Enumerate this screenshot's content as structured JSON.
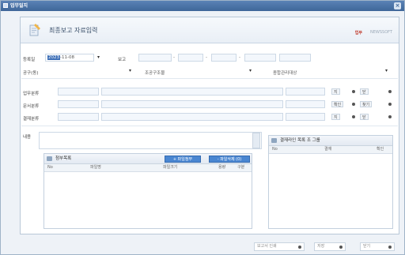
{
  "window": {
    "title": "업무일지"
  },
  "header": {
    "title": "최종보고 자료입력",
    "brand": "업무",
    "brand_sub": "NEWSSOFT"
  },
  "form": {
    "reg_date_label": "등록일",
    "reg_date_value_hl": "2023",
    "reg_date_value_rest": "-11-08",
    "report_label": "보고",
    "dept_label": "공구(동)",
    "section_label": "조공구조물",
    "type_label": "종합관리대상",
    "work_label": "업무분류",
    "doc_label": "문서분류",
    "recv_label": "결재분류",
    "memo_label": "내용"
  },
  "row_buttons": {
    "r1": [
      "지",
      "닫"
    ],
    "r2": [
      "확인",
      "찾기"
    ],
    "r3": [
      "지",
      "닫"
    ]
  },
  "attach": {
    "title": "첨부목록",
    "add_btn": "+ 파일첨부",
    "del_btn": "- 파일삭제 (0)",
    "cols": [
      "No",
      "파일명",
      "파일크기",
      "용량",
      "구분"
    ]
  },
  "approval": {
    "title": "결재라인 목록 조 그룹",
    "cols": [
      "No",
      "결재",
      "확인"
    ]
  },
  "footer": {
    "btn1": "보고서 인쇄",
    "btn2": "저장",
    "btn3": "닫기"
  },
  "colors": {
    "accent": "#3f6699",
    "brand": "#c0392b",
    "button": "#4a86d1"
  }
}
